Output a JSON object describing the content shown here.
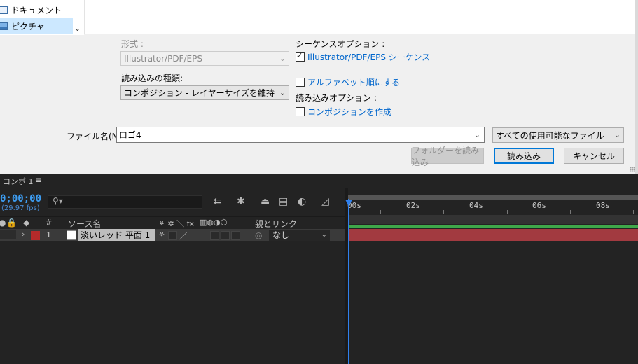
{
  "nav": {
    "items": [
      {
        "label": "ドキュメント"
      },
      {
        "label": "ピクチャ"
      }
    ]
  },
  "format": {
    "label": "形式 :",
    "value": "Illustrator/PDF/EPS"
  },
  "import_as": {
    "label": "読み込みの種類:",
    "value": "コンポジション - レイヤーサイズを維持"
  },
  "sequence_options": {
    "label": "シーケンスオプション :",
    "seq_checkbox_label": "Illustrator/PDF/EPS シーケンス",
    "seq_checked": true,
    "alpha_checkbox_label": "アルファベット順にする",
    "alpha_checked": false
  },
  "import_options": {
    "label": "読み込みオプション :",
    "comp_checkbox_label": "コンポジションを作成",
    "comp_checked": false
  },
  "filename": {
    "label": "ファイル名(N):",
    "value": "ロゴ4"
  },
  "filetype": {
    "value": "すべての使用可能なファイル"
  },
  "buttons": {
    "import_folder": "フォルダーを読み込み",
    "import": "読み込み",
    "cancel": "キャンセル"
  },
  "panel": {
    "tab_title": "コンポ 1",
    "tab_menu": "≡",
    "timecode": "0;00;00",
    "fps": "(29.97 fps)",
    "search_placeholder": ""
  },
  "columns": {
    "hash": "#",
    "source_name": "ソース名",
    "parent_link": "親とリンク",
    "switches": "⚘ ✲ ＼ fx"
  },
  "layer": {
    "number": "1",
    "name": "淡いレッド 平面 1",
    "parent": "なし",
    "label_color": "#b52a2a"
  },
  "ruler": {
    "labels": [
      "00s",
      "02s",
      "04s",
      "06s",
      "08s"
    ]
  },
  "colors": {
    "accent": "#2f80ed",
    "link": "#0066cc",
    "layer_bar": "#a23a40",
    "green_bar": "#3fa84a"
  }
}
